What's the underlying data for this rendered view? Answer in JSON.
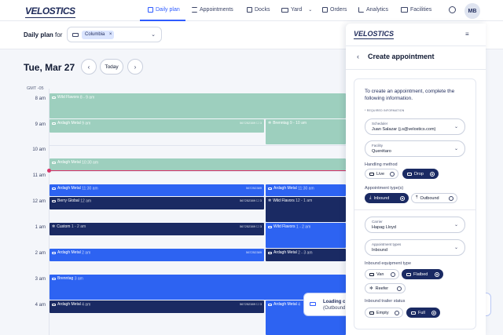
{
  "nav": {
    "logo": "VELOSTICS",
    "items": [
      {
        "label": "Daily plan",
        "icon": "calendar-icon"
      },
      {
        "label": "Appointments",
        "icon": "list-icon"
      },
      {
        "label": "Docks",
        "icon": "bookmark-icon"
      },
      {
        "label": "Yard",
        "icon": "truck-icon"
      },
      {
        "label": "Orders",
        "icon": "orders-icon"
      },
      {
        "label": "Analytics",
        "icon": "chart-icon"
      },
      {
        "label": "Facilities",
        "icon": "facility-icon"
      }
    ],
    "active": "Daily plan",
    "avatar": "MB"
  },
  "planbar": {
    "label_prefix": "Daily plan",
    "label_suffix": "for",
    "facility_chip": "Columbia",
    "chip_close": "×"
  },
  "calendar": {
    "date": "Tue, Mar 27",
    "prev": "‹",
    "next": "›",
    "today": "Today",
    "timezone": "GMT -05",
    "hours": [
      "8 am",
      "9 am",
      "10 am",
      "11 am",
      "12 am",
      "1 am",
      "2 am",
      "3 am",
      "4 am"
    ],
    "events": [
      {
        "name": "Wild Flavors",
        "time": "8 - 9 am",
        "docs": "",
        "color": "teal"
      },
      {
        "name": "Ardagh Metal",
        "time": "9 am",
        "docs": "567252389  ☐ 3",
        "color": "teal"
      },
      {
        "name": "Brenntag",
        "time": "9 - 10 am",
        "docs": "",
        "color": "teal"
      },
      {
        "name": "Ardagh Metal",
        "time": "10:30 am",
        "docs": "",
        "color": "teal"
      },
      {
        "name": "Ardagh Metal",
        "time": "11:30 am",
        "docs": "567252389",
        "color": "blue"
      },
      {
        "name": "Ardagh Metal",
        "time": "11:30 am",
        "docs": "",
        "color": "blue"
      },
      {
        "name": "Berry Global",
        "time": "12 am",
        "docs": "567252389  ☐ 3",
        "color": "navy"
      },
      {
        "name": "Wild Flavors",
        "time": "12 - 1 am",
        "docs": "",
        "color": "navy"
      },
      {
        "name": "Custom",
        "time": "1 - 2 am",
        "docs": "567252389  ☐ 3",
        "color": "navy"
      },
      {
        "name": "Wild Flavors",
        "time": "1 - 2 am",
        "docs": "",
        "color": "blue"
      },
      {
        "name": "Ardagh Metal",
        "time": "2 am",
        "docs": "567252389",
        "color": "blue"
      },
      {
        "name": "Ardagh Metal",
        "time": "2 - 3 am",
        "docs": "",
        "color": "navy"
      },
      {
        "name": "Brenntag",
        "time": "3 am",
        "docs": "",
        "color": "blue"
      },
      {
        "name": "Ardagh Metal",
        "time": "4 am",
        "docs": "567252389  ☐ 3",
        "color": "navy"
      },
      {
        "name": "Ardagh Metal",
        "time": "4",
        "docs": "",
        "color": "blue"
      }
    ]
  },
  "toast": {
    "line1": "Loading c",
    "line2": "(Outbound"
  },
  "panel": {
    "logo": "VELOSTICS",
    "title": "Create appointment",
    "intro": "To create an appointment, complete the following information.",
    "required_note": "* REQUIRED INFORMATION",
    "scheduler": {
      "label": "Scheduler",
      "value": "Juan Salazar (j.s@velostics.com)"
    },
    "facility": {
      "label": "Facility",
      "value": "Querétaro"
    },
    "handling_method": {
      "label": "Handling method",
      "options": [
        "Live",
        "Drop"
      ],
      "selected": "Drop"
    },
    "appointment_types": {
      "label": "Appointment type(s)",
      "options": [
        "Inbound",
        "Outbound"
      ],
      "selected": "Inbound"
    },
    "carrier": {
      "label": "Carrier",
      "value": "Hapag Lloyd"
    },
    "appointment_type_field": {
      "label": "Appointment types",
      "value": "Inbound"
    },
    "equipment_type": {
      "label": "Inbound equipment type",
      "options": [
        "Van",
        "Flatbed",
        "Reefer"
      ],
      "selected": "Flatbed"
    },
    "trailer_status": {
      "label": "Inbound trailer status",
      "options": [
        "Empty",
        "Full"
      ],
      "selected": "Full"
    }
  },
  "colors": {
    "accent": "#2e5bff",
    "teal": "#9dcfbe",
    "blue": "#2d63f2",
    "navy": "#1a2a63",
    "now": "#d8356a"
  }
}
